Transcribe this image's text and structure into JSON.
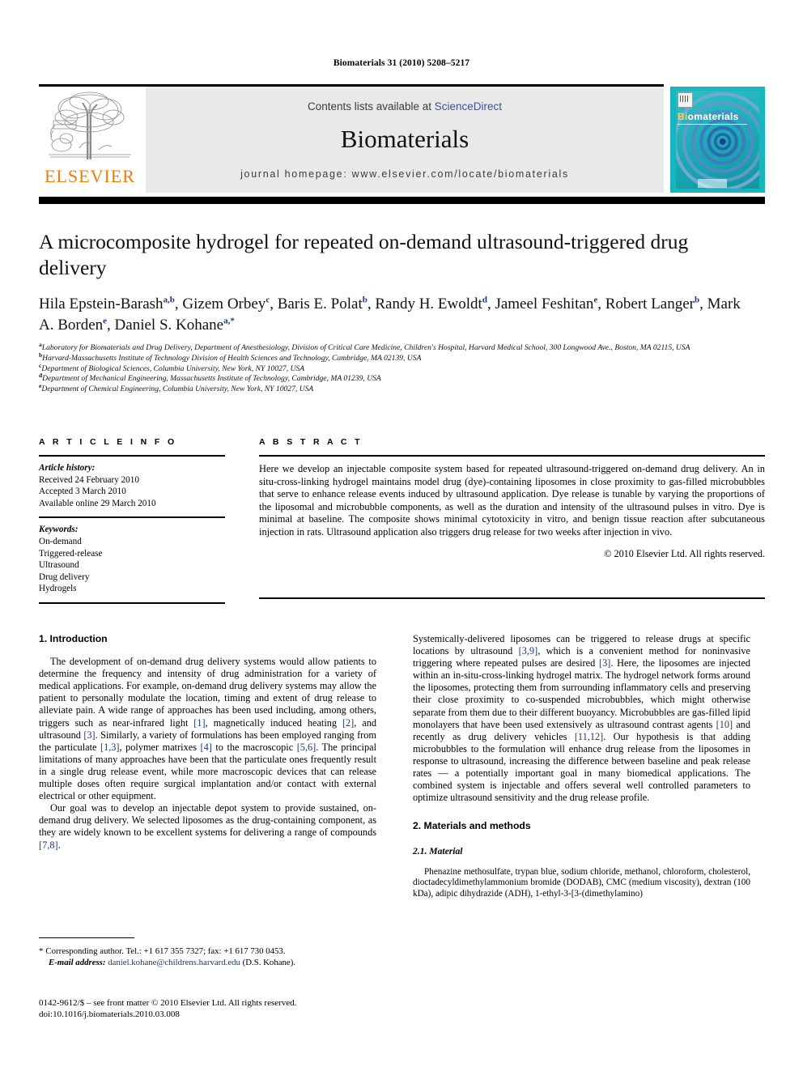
{
  "running_head": "Biomaterials 31 (2010) 5208–5217",
  "header": {
    "contents_prefix": "Contents lists available at ",
    "sciencedirect": "ScienceDirect",
    "journal_title": "Biomaterials",
    "homepage": "journal homepage: www.elsevier.com/locate/biomaterials",
    "elsevier_wordmark": "ELSEVIER",
    "elsevier_orange": "#f07d00",
    "sciencedirect_color": "#3853a4",
    "cover_brand_bi": "Bi",
    "cover_brand_rest": "omaterials",
    "band_color": "#e9e9e9"
  },
  "article": {
    "title": "A microcomposite hydrogel for repeated on-demand ultrasound-triggered drug delivery",
    "authors_line1_a": "Hila Epstein-Barash",
    "authors_line1_a_sup": "a,b",
    "authors_line1_b": ", Gizem Orbey",
    "authors_line1_b_sup": "c",
    "authors_line1_c": ", Baris E. Polat",
    "authors_line1_c_sup": "b",
    "authors_line1_d": ", Randy H. Ewoldt",
    "authors_line1_d_sup": "d",
    "authors_line1_e": ", Jameel Feshitan",
    "authors_line1_e_sup": "e",
    "authors_line2_a": ", Robert Langer",
    "authors_line2_a_sup": "b",
    "authors_line2_b": ", Mark A. Borden",
    "authors_line2_b_sup": "e",
    "authors_line2_c": ", Daniel S. Kohane",
    "authors_line2_c_sup": "a,*",
    "affiliations": [
      {
        "sup": "a",
        "text": "Laboratory for Biomaterials and Drug Delivery, Department of Anesthesiology, Division of Critical Care Medicine, Children's Hospital, Harvard Medical School, 300 Longwood Ave., Boston, MA 02115, USA"
      },
      {
        "sup": "b",
        "text": "Harvard-Massachusetts Institute of Technology Division of Health Sciences and Technology, Cambridge, MA 02139, USA"
      },
      {
        "sup": "c",
        "text": "Department of Biological Sciences, Columbia University, New York, NY 10027, USA"
      },
      {
        "sup": "d",
        "text": "Department of Mechanical Engineering, Massachusetts Institute of Technology, Cambridge, MA 01239, USA"
      },
      {
        "sup": "e",
        "text": "Department of Chemical Engineering, Columbia University, New York, NY 10027, USA"
      }
    ]
  },
  "article_info": {
    "heading": "A R T I C L E   I N F O",
    "history_label": "Article history:",
    "history": [
      "Received 24 February 2010",
      "Accepted 3 March 2010",
      "Available online 29 March 2010"
    ],
    "keywords_label": "Keywords:",
    "keywords": [
      "On-demand",
      "Triggered-release",
      "Ultrasound",
      "Drug delivery",
      "Hydrogels"
    ]
  },
  "abstract": {
    "heading": "A B S T R A C T",
    "text": "Here we develop an injectable composite system based for repeated ultrasound-triggered on-demand drug delivery. An in situ-cross-linking hydrogel maintains model drug (dye)-containing liposomes in close proximity to gas-filled microbubbles that serve to enhance release events induced by ultrasound application. Dye release is tunable by varying the proportions of the liposomal and microbubble components, as well as the duration and intensity of the ultrasound pulses in vitro. Dye is minimal at baseline. The composite shows minimal cytotoxicity in vitro, and benign tissue reaction after subcutaneous injection in rats. Ultrasound application also triggers drug release for two weeks after injection in vivo.",
    "copyright": "© 2010 Elsevier Ltd. All rights reserved."
  },
  "body": {
    "section1_heading": "1. Introduction",
    "left_p1_part1": "The development of on-demand drug delivery systems would allow patients to determine the frequency and intensity of drug administration for a variety of medical applications. For example, on-demand drug delivery systems may allow the patient to personally modulate the location, timing and extent of drug release to alleviate pain. A wide range of approaches has been used including, among others, triggers such as near-infrared light ",
    "left_p1_ref1": "[1]",
    "left_p1_part2": ", magnetically induced heating ",
    "left_p1_ref2": "[2]",
    "left_p1_part3": ", and ultrasound ",
    "left_p1_ref3": "[3]",
    "left_p1_part4": ". Similarly, a variety of formulations has been employed ranging from the particulate ",
    "left_p1_ref4": "[1,3]",
    "left_p1_part5": ", polymer matrixes ",
    "left_p1_ref5": "[4]",
    "left_p1_part6": " to the macroscopic ",
    "left_p1_ref6": "[5,6]",
    "left_p1_part7": ". The principal limitations of many approaches have been that the particulate ones frequently result in a single drug release event, while more macroscopic devices that can release multiple doses often require surgical implantation and/or contact with external electrical or other equipment.",
    "left_p2_part1": "Our goal was to develop an injectable depot system to provide sustained, on-demand drug delivery. We selected liposomes as the drug-containing component, as they are widely known to be excellent systems for delivering a range of compounds ",
    "left_p2_ref1": "[7,8]",
    "left_p2_part2": ".",
    "right_p1_part1": "Systemically-delivered liposomes can be triggered to release drugs at specific locations by ultrasound ",
    "right_p1_ref1": "[3,9]",
    "right_p1_part2": ", which is a convenient method for noninvasive triggering where repeated pulses are desired ",
    "right_p1_ref2": "[3]",
    "right_p1_part3": ". Here, the liposomes are injected within an in-situ-cross-linking hydrogel matrix. The hydrogel network forms around the liposomes, protecting them from surrounding inflammatory cells and preserving their close proximity to co-suspended microbubbles, which might otherwise separate from them due to their different buoyancy. Microbubbles are gas-filled lipid monolayers that have been used extensively as ultrasound contrast agents ",
    "right_p1_ref3": "[10]",
    "right_p1_part4": " and recently as drug delivery vehicles ",
    "right_p1_ref4": "[11,12]",
    "right_p1_part5": ". Our hypothesis is that adding microbubbles to the formulation will enhance drug release from the liposomes in response to ultrasound, increasing the difference between baseline and peak release rates — a potentially important goal in many biomedical applications. The combined system is injectable and offers several well controlled parameters to optimize ultrasound sensitivity and the drug release profile.",
    "section2_heading": "2. Materials and methods",
    "section21_heading": "2.1. Material",
    "right_p2": "Phenazine methosulfate, trypan blue, sodium chloride, methanol, chloroform, cholesterol, dioctadecyldimethylammonium bromide (DODAB), CMC (medium viscosity), dextran (100 kDa), adipic dihydrazide (ADH), 1-ethyl-3-[3-(dimethylamino)"
  },
  "footnote": {
    "star": "*",
    "corresponding": "Corresponding author. Tel.: +1 617 355 7327; fax: +1 617 730 0453.",
    "email_label": "E-mail address:",
    "email": "daniel.kohane@childrens.harvard.edu",
    "email_suffix": "(D.S. Kohane).",
    "email_color": "#1b3a72"
  },
  "footer": {
    "line1": "0142-9612/$ – see front matter © 2010 Elsevier Ltd. All rights reserved.",
    "line2": "doi:10.1016/j.biomaterials.2010.03.008"
  }
}
